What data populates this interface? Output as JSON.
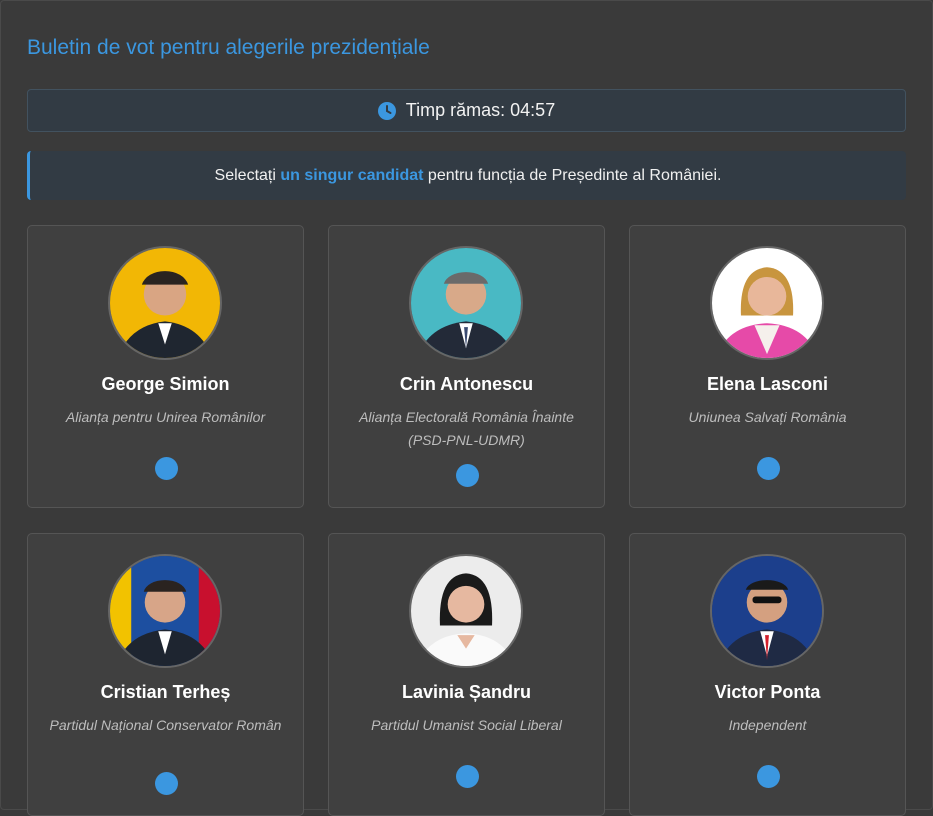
{
  "header": {
    "title": "Buletin de vot pentru alegerile prezidențiale"
  },
  "timer": {
    "icon": "clock-icon",
    "label": "Timp rămas:",
    "value": "04:57"
  },
  "notice": {
    "before": "Selectați ",
    "highlight": "un singur candidat",
    "after": " pentru funcția de Președinte al României."
  },
  "candidates": [
    {
      "name": "George Simion",
      "party": "Alianța pentru Unirea Românilor",
      "photo_bg": "#f2b705"
    },
    {
      "name": "Crin Antonescu",
      "party": "Alianța Electorală România Înainte (PSD-PNL-UDMR)",
      "photo_bg": "#49b9c4"
    },
    {
      "name": "Elena Lasconi",
      "party": "Uniunea Salvați România",
      "photo_bg": "#ffffff"
    },
    {
      "name": "Cristian Terheș",
      "party": "Partidul Național Conservator Român",
      "photo_bg": "#1d4fa0"
    },
    {
      "name": "Lavinia Șandru",
      "party": "Partidul Umanist Social Liberal",
      "photo_bg": "#ececec"
    },
    {
      "name": "Victor Ponta",
      "party": "Independent",
      "photo_bg": "#1c3f8c"
    }
  ],
  "colors": {
    "accent": "#3b97e0",
    "background": "#3a3a3a",
    "card": "#404040"
  }
}
